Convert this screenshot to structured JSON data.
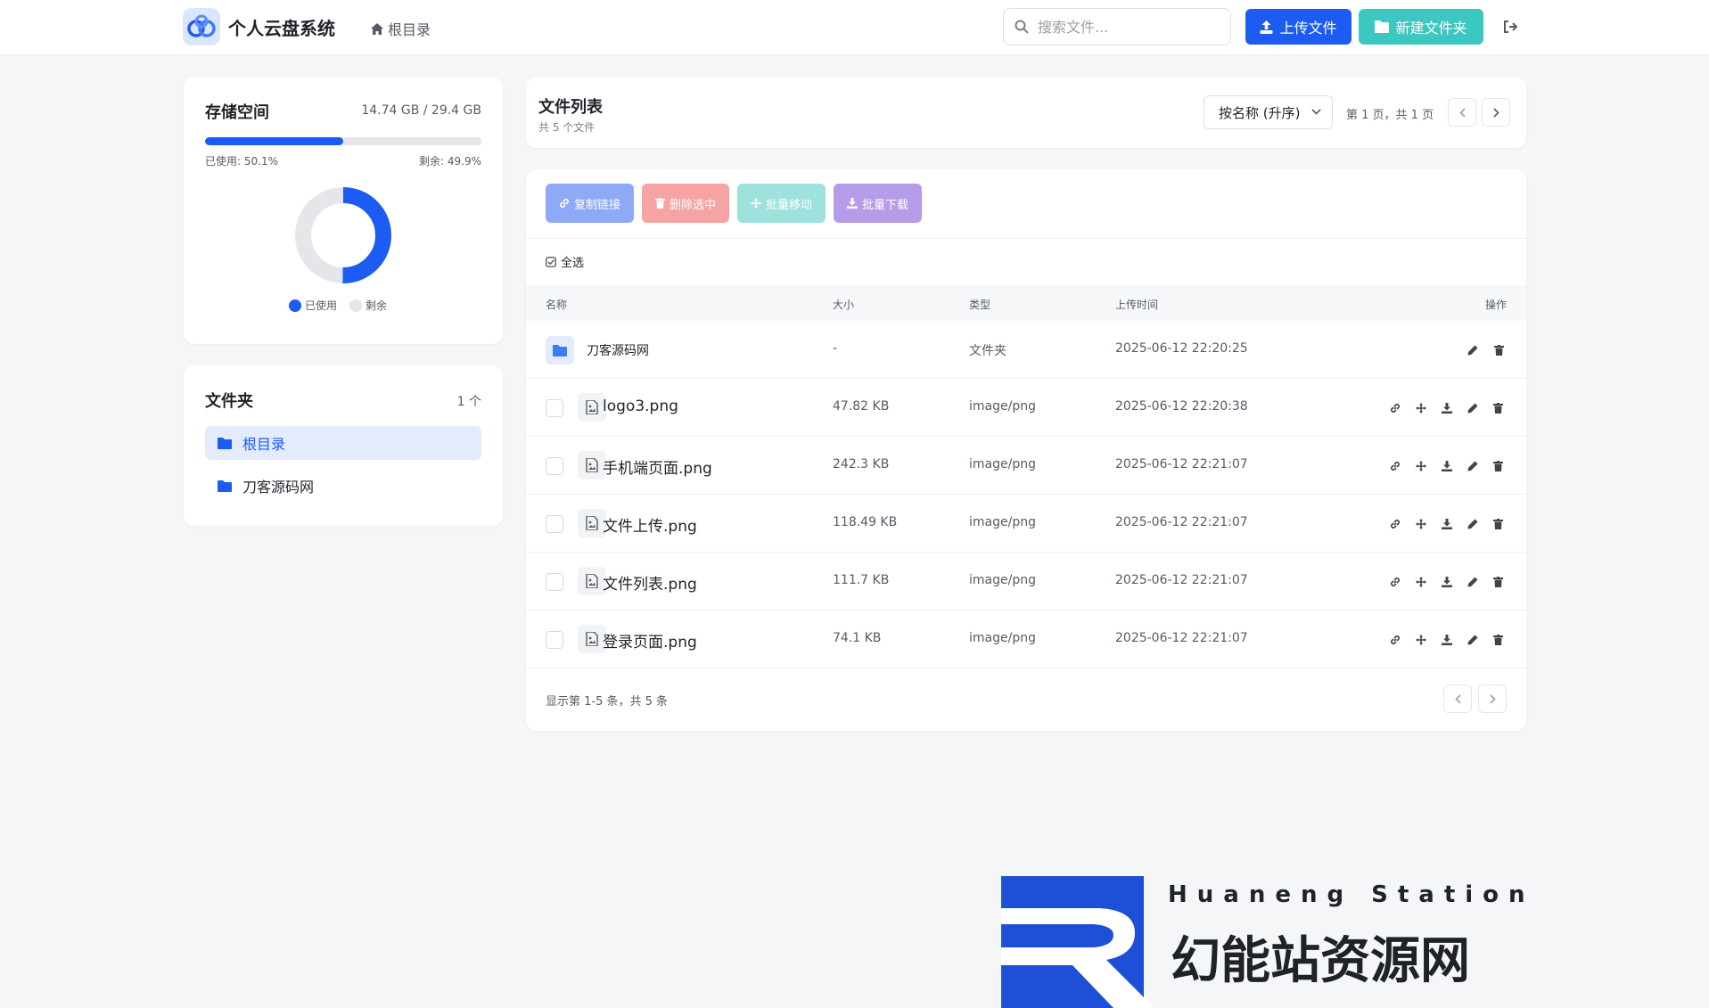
{
  "header": {
    "app_title": "个人云盘系统",
    "breadcrumb": "根目录",
    "search_placeholder": "搜索文件...",
    "upload_label": "上传文件",
    "new_folder_label": "新建文件夹"
  },
  "storage": {
    "title": "存储空间",
    "amount": "14.74 GB / 29.4 GB",
    "used_fraction": 0.501,
    "used_label": "已使用: 50.1%",
    "free_label": "剩余: 49.9%",
    "legend_used": "已使用",
    "legend_free": "剩余",
    "colors": {
      "used": "#1d5cf2",
      "free": "#e4e6ea"
    }
  },
  "folders": {
    "title": "文件夹",
    "count": "1 个",
    "items": [
      {
        "label": "根目录",
        "active": true
      },
      {
        "label": "刀客源码网",
        "active": false
      }
    ]
  },
  "list": {
    "title": "文件列表",
    "subtitle": "共 5 个文件",
    "sort_value": "按名称 (升序)",
    "page_info": "第 1 页，共 1 页",
    "bulk": {
      "copy": "复制链接",
      "delete": "删除选中",
      "move": "批量移动",
      "download": "批量下载"
    },
    "select_all": "全选",
    "columns": {
      "name": "名称",
      "size": "大小",
      "type": "类型",
      "time": "上传时间",
      "ops": "操作"
    },
    "rows": [
      {
        "name": "刀客源码网",
        "size": "-",
        "type": "文件夹",
        "time": "2025-06-12 22:20:25",
        "kind": "folder"
      },
      {
        "name": "logo3.png",
        "size": "47.82 KB",
        "type": "image/png",
        "time": "2025-06-12 22:20:38",
        "kind": "file"
      },
      {
        "name": "手机端页面.png",
        "size": "242.3 KB",
        "type": "image/png",
        "time": "2025-06-12 22:21:07",
        "kind": "file"
      },
      {
        "name": "文件上传.png",
        "size": "118.49 KB",
        "type": "image/png",
        "time": "2025-06-12 22:21:07",
        "kind": "file"
      },
      {
        "name": "文件列表.png",
        "size": "111.7 KB",
        "type": "image/png",
        "time": "2025-06-12 22:21:07",
        "kind": "file"
      },
      {
        "name": "登录页面.png",
        "size": "74.1 KB",
        "type": "image/png",
        "time": "2025-06-12 22:21:07",
        "kind": "file"
      }
    ],
    "footer": "显示第 1-5 条，共 5 条"
  },
  "watermark": {
    "english": "Huaneng Station",
    "chinese": "幻能站资源网"
  }
}
